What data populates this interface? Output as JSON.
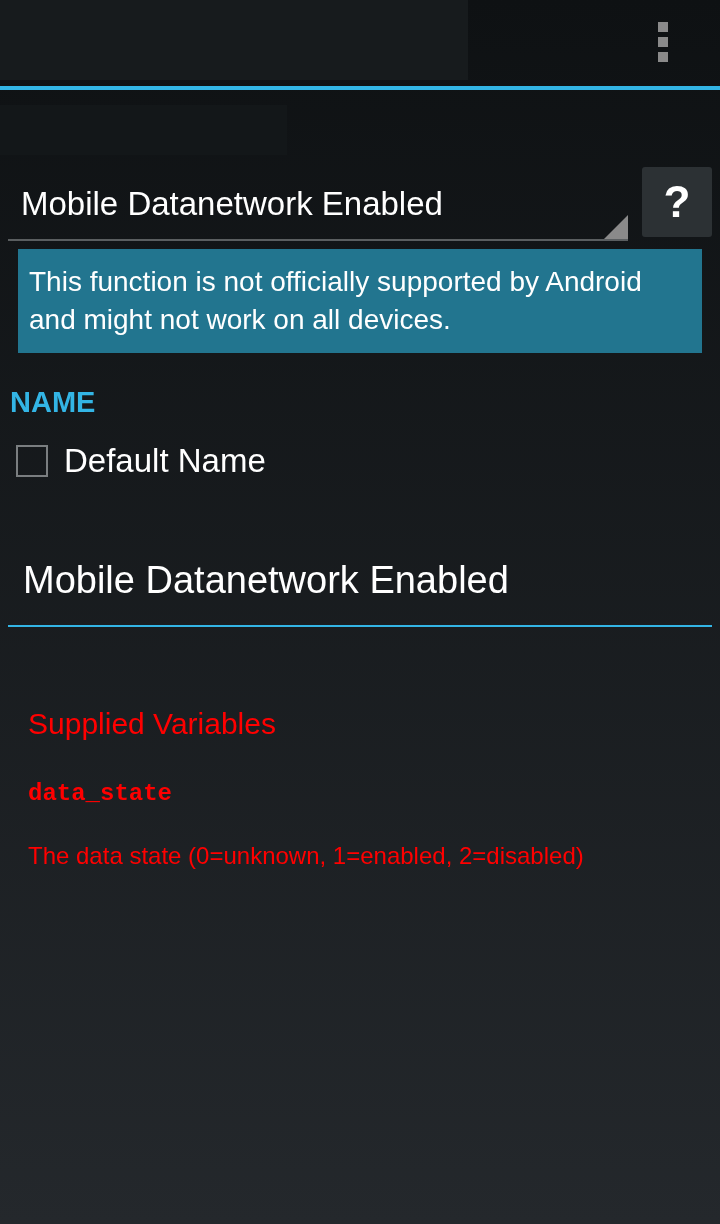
{
  "spinner": {
    "value": "Mobile Datanetwork Enabled"
  },
  "help_button": {
    "label": "?"
  },
  "notice": "This function is not officially supported by Android and might not work on all devices.",
  "name_section": {
    "heading": "NAME",
    "checkbox": {
      "label": "Default Name",
      "checked": false
    },
    "field": {
      "value": "Mobile Datanetwork Enabled"
    }
  },
  "variables": {
    "heading": "Supplied Variables",
    "items": [
      {
        "name": "data_state",
        "description": "The data state (0=unknown, 1=enabled, 2=disabled)"
      }
    ]
  }
}
